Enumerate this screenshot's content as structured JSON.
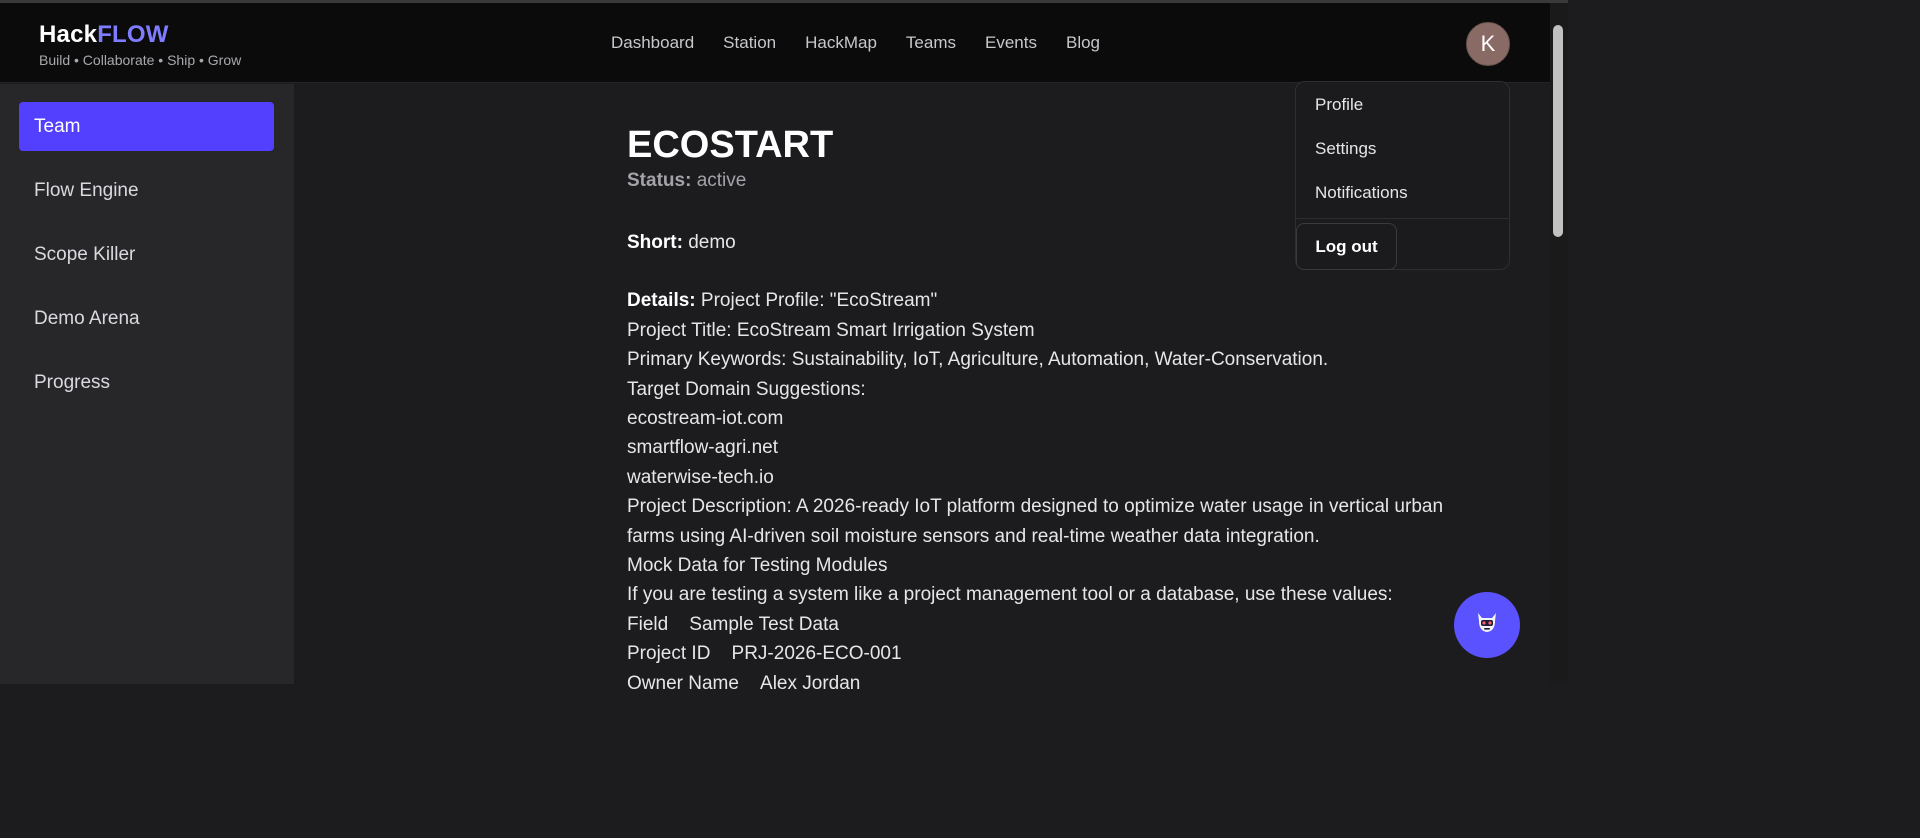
{
  "brand": {
    "name_part1": "Hack",
    "name_part2": "FLOW",
    "tagline": "Build • Collaborate • Ship • Grow"
  },
  "nav": [
    "Dashboard",
    "Station",
    "HackMap",
    "Teams",
    "Events",
    "Blog"
  ],
  "user": {
    "avatar_initial": "K"
  },
  "user_menu": {
    "items": [
      "Profile",
      "Settings",
      "Notifications"
    ],
    "logout_label": "Log out"
  },
  "sidebar": {
    "items": [
      "Team",
      "Flow Engine",
      "Scope Killer",
      "Demo Arena",
      "Progress"
    ],
    "active": "Team"
  },
  "project": {
    "title": "ECOSTART",
    "status_label": "Status:",
    "status_value": "active",
    "short_label": "Short:",
    "short_value": "demo",
    "details_label": "Details:",
    "details_first": "Project Profile: \"EcoStream\"",
    "details_lines": [
      "Project Title: EcoStream Smart Irrigation System",
      "Primary Keywords: Sustainability, IoT, Agriculture, Automation, Water-Conservation.",
      "Target Domain Suggestions:",
      "ecostream-iot.com",
      "smartflow-agri.net",
      "waterwise-tech.io",
      "Project Description: A 2026-ready IoT platform designed to optimize water usage in vertical urban",
      "farms using AI-driven soil moisture sensors and real-time weather data integration.",
      "Mock Data for Testing Modules",
      "If you are testing a system like a project management tool or a database, use these values:",
      "Field    Sample Test Data",
      "Project ID    PRJ-2026-ECO-001",
      "Owner Name    Alex Jordan"
    ]
  },
  "colors": {
    "accent": "#5340ff",
    "brand_accent": "#7f7cff",
    "fab": "#5b52ff"
  },
  "icons": {
    "fab": "robot-assistant-icon"
  }
}
